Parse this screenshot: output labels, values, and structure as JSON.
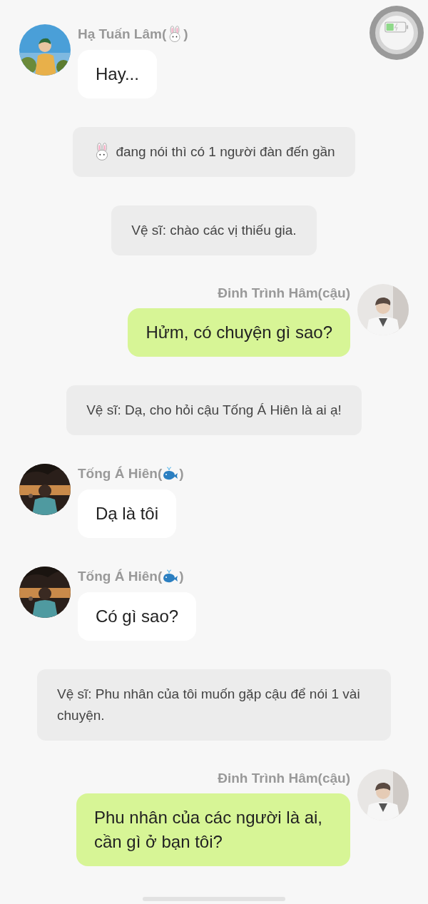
{
  "messages": [
    {
      "kind": "left",
      "name": "Hạ Tuấn Lâm(",
      "name_end": ")",
      "text": "Hay..."
    },
    {
      "kind": "system",
      "text": "đang nói thì có 1 người đàn đến gần"
    },
    {
      "kind": "system",
      "text": "Vệ sĩ: chào các vị thiếu gia."
    },
    {
      "kind": "right",
      "name": "Đinh Trình Hâm(cậu)",
      "text": "Hửm, có chuyện gì sao?"
    },
    {
      "kind": "system",
      "text": "Vệ sĩ: Dạ, cho hỏi cậu Tống Á Hiên là ai ạ!"
    },
    {
      "kind": "left",
      "name": "Tống Á Hiên(",
      "name_end": ")",
      "text": "Dạ là tôi"
    },
    {
      "kind": "left",
      "name": "Tống Á Hiên(",
      "name_end": ")",
      "text": "Có gì sao?"
    },
    {
      "kind": "system",
      "text": "Vệ sĩ: Phu nhân của tôi muốn gặp cậu để nói 1 vài chuyện."
    },
    {
      "kind": "right",
      "name": "Đinh Trình Hâm(cậu)",
      "text": "Phu nhân của các người là ai, cần gì ở bạn tôi?"
    }
  ]
}
